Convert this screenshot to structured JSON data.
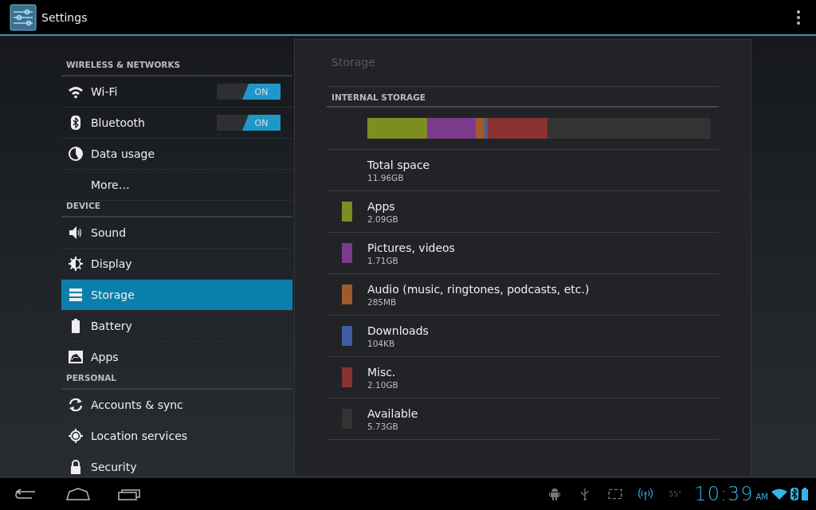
{
  "action_bar": {
    "title": "Settings"
  },
  "sidebar": {
    "sections": [
      {
        "header": "WIRELESS & NETWORKS",
        "items": [
          {
            "label": "Wi-Fi",
            "kind": "toggle",
            "on": true,
            "toggle_label": "ON",
            "selected": false
          },
          {
            "label": "Bluetooth",
            "kind": "toggle",
            "on": true,
            "toggle_label": "ON",
            "selected": false
          },
          {
            "label": "Data usage",
            "kind": "plain",
            "selected": false
          },
          {
            "label": "More…",
            "kind": "plain",
            "selected": false
          }
        ]
      },
      {
        "header": "DEVICE",
        "items": [
          {
            "label": "Sound",
            "kind": "plain",
            "selected": false
          },
          {
            "label": "Display",
            "kind": "plain",
            "selected": false
          },
          {
            "label": "Storage",
            "kind": "plain",
            "selected": true
          },
          {
            "label": "Battery",
            "kind": "plain",
            "selected": false
          },
          {
            "label": "Apps",
            "kind": "plain",
            "selected": false
          }
        ]
      },
      {
        "header": "PERSONAL",
        "items": [
          {
            "label": "Accounts & sync",
            "kind": "plain",
            "selected": false
          },
          {
            "label": "Location services",
            "kind": "plain",
            "selected": false
          },
          {
            "label": "Security",
            "kind": "plain",
            "selected": false
          }
        ]
      }
    ]
  },
  "detail": {
    "title": "Storage",
    "section": "INTERNAL STORAGE",
    "total": {
      "label": "Total space",
      "value": "11.96GB"
    },
    "categories": [
      {
        "label": "Apps",
        "value": "2.09GB",
        "color": "#7f8c1f"
      },
      {
        "label": "Pictures, videos",
        "value": "1.71GB",
        "color": "#7b3a8c"
      },
      {
        "label": "Audio (music, ringtones, podcasts, etc.)",
        "value": "285MB",
        "color": "#a2592a"
      },
      {
        "label": "Downloads",
        "value": "104KB",
        "color": "#3d5ea0"
      },
      {
        "label": "Misc.",
        "value": "2.10GB",
        "color": "#8a3131"
      },
      {
        "label": "Available",
        "value": "5.73GB",
        "color": "#333333"
      }
    ]
  },
  "status_bar": {
    "temperature": "55°",
    "time": "10:39",
    "meridiem": "AM"
  }
}
